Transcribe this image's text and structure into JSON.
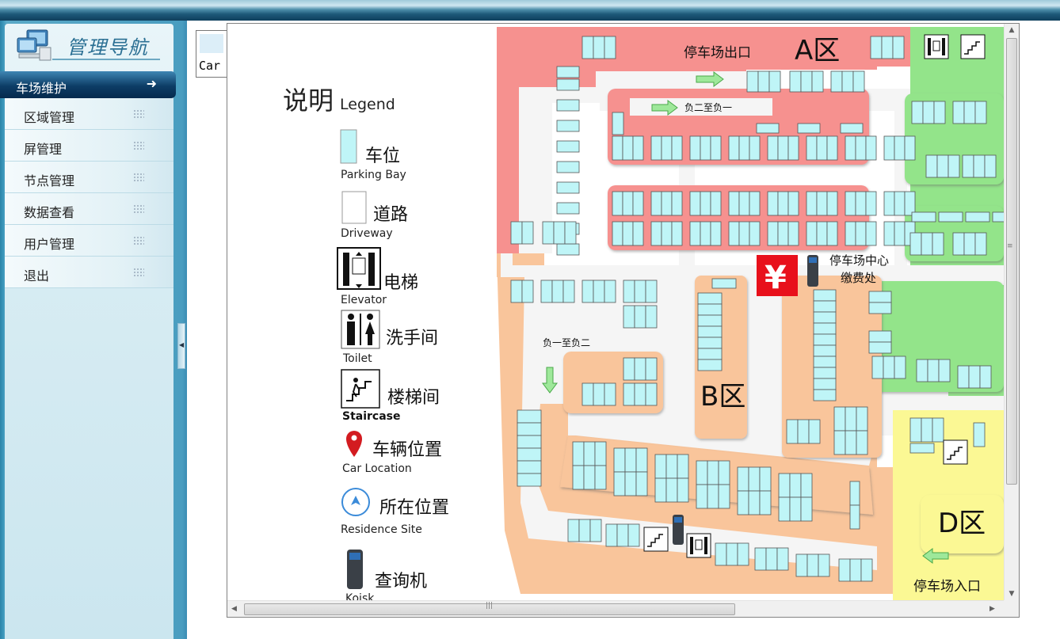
{
  "nav": {
    "title": "管理导航",
    "items": [
      {
        "label": "车场维护",
        "active": true,
        "icon": "arrow-right-icon"
      },
      {
        "label": "区域管理"
      },
      {
        "label": "屏管理"
      },
      {
        "label": "节点管理"
      },
      {
        "label": "数据查看"
      },
      {
        "label": "用户管理"
      },
      {
        "label": "退出"
      }
    ]
  },
  "tree_label": "Car",
  "legend": {
    "title_cn": "说明",
    "title_en": "Legend",
    "items": [
      {
        "cn": "车位",
        "en": "Parking Bay",
        "icon": "parking-bay-icon"
      },
      {
        "cn": "道路",
        "en": "Driveway",
        "icon": "driveway-icon"
      },
      {
        "cn": "电梯",
        "en": "Elevator",
        "icon": "elevator-icon"
      },
      {
        "cn": "洗手间",
        "en": "Toilet",
        "icon": "toilet-icon"
      },
      {
        "cn": "楼梯间",
        "en": "Staircase",
        "icon": "staircase-icon"
      },
      {
        "cn": "车辆位置",
        "en": "Car Location",
        "icon": "car-location-icon"
      },
      {
        "cn": "所在位置",
        "en": "Residence Site",
        "icon": "residence-site-icon"
      },
      {
        "cn": "查询机",
        "en": "Koisk",
        "icon": "kiosk-icon"
      }
    ]
  },
  "map": {
    "exit_label": "停车场出口",
    "entrance_label": "停车场入口",
    "zone_a": "A区",
    "zone_b": "B区",
    "zone_d": "D区",
    "ramp_down": "负二至负一",
    "ramp_up": "负一至负二",
    "center_line1": "停车场中心",
    "center_line2": "缴费处",
    "yen": "¥",
    "colors": {
      "zone_a": "#f6918f",
      "zone_b": "#f9c59b",
      "zone_c": "#93e48a",
      "zone_d": "#fbf894",
      "bay": "#bff5f7",
      "road": "#f5f5f5"
    }
  }
}
